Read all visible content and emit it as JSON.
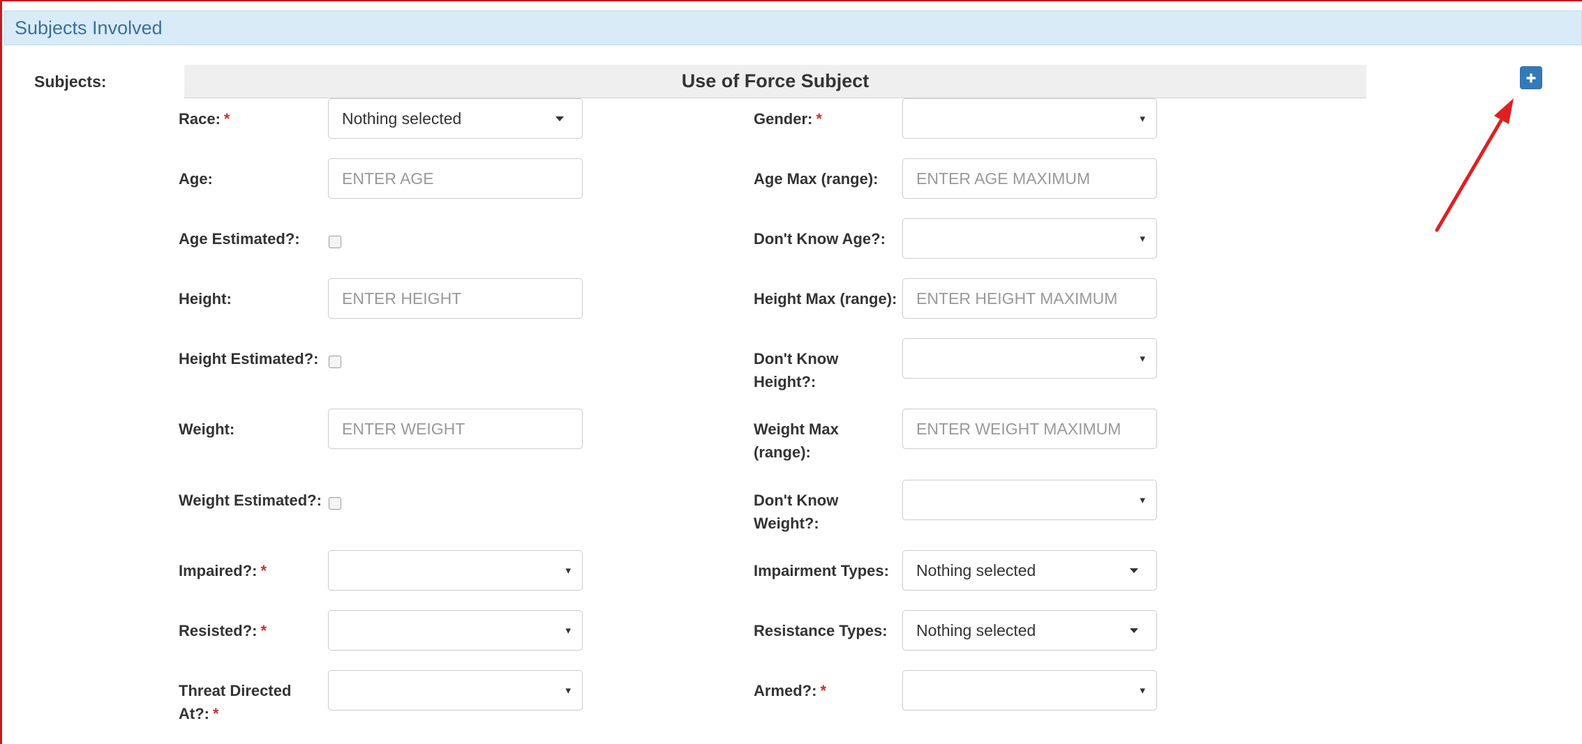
{
  "panel": {
    "title": "Subjects Involved"
  },
  "subjects_label": "Subjects:",
  "subject_header": "Use of Force Subject",
  "add_button": {
    "icon": "plus-icon"
  },
  "colors": {
    "accent": "#337ab7",
    "heading_bg": "#d9ebf6",
    "required": "#c9302c",
    "annotation": "#e02020"
  },
  "left_fields": [
    {
      "label": "Race:",
      "required": true,
      "type": "bs-select",
      "value": "Nothing selected"
    },
    {
      "label": "Age:",
      "required": false,
      "type": "input",
      "placeholder": "ENTER AGE"
    },
    {
      "label": "Age Estimated?:",
      "required": false,
      "type": "checkbox",
      "checked": false
    },
    {
      "label": "Height:",
      "required": false,
      "type": "input",
      "placeholder": "ENTER HEIGHT"
    },
    {
      "label": "Height Estimated?:",
      "required": false,
      "type": "checkbox",
      "checked": false
    },
    {
      "label": "Weight:",
      "required": false,
      "type": "input",
      "placeholder": "ENTER WEIGHT"
    },
    {
      "label": "Weight Estimated?:",
      "required": false,
      "type": "checkbox",
      "checked": false
    },
    {
      "label": "Impaired?:",
      "required": true,
      "type": "select",
      "value": ""
    },
    {
      "label": "Resisted?:",
      "required": true,
      "type": "select",
      "value": ""
    },
    {
      "label_line1": "Threat Directed",
      "label_line2": "At?:",
      "required": true,
      "type": "select",
      "value": ""
    }
  ],
  "right_fields": [
    {
      "label": "Gender:",
      "required": true,
      "type": "select",
      "value": ""
    },
    {
      "label": "Age Max (range):",
      "required": false,
      "type": "input",
      "placeholder": "ENTER AGE MAXIMUM"
    },
    {
      "label": "Don't Know Age?:",
      "required": false,
      "type": "select",
      "value": ""
    },
    {
      "label": "Height Max (range):",
      "required": false,
      "type": "input",
      "placeholder": "ENTER HEIGHT MAXIMUM"
    },
    {
      "label_line1": "Don't Know",
      "label_line2": "Height?:",
      "required": false,
      "type": "select",
      "value": ""
    },
    {
      "label_line1": "Weight Max",
      "label_line2": "(range):",
      "required": false,
      "type": "input",
      "placeholder": "ENTER WEIGHT MAXIMUM"
    },
    {
      "label_line1": "Don't Know",
      "label_line2": "Weight?:",
      "required": false,
      "type": "select",
      "value": ""
    },
    {
      "label": "Impairment Types:",
      "required": false,
      "type": "bs-select",
      "value": "Nothing selected"
    },
    {
      "label": "Resistance Types:",
      "required": false,
      "type": "bs-select",
      "value": "Nothing selected"
    },
    {
      "label": "Armed?:",
      "required": true,
      "type": "select",
      "value": ""
    }
  ],
  "required_marker": "*",
  "select_caret": "▾"
}
